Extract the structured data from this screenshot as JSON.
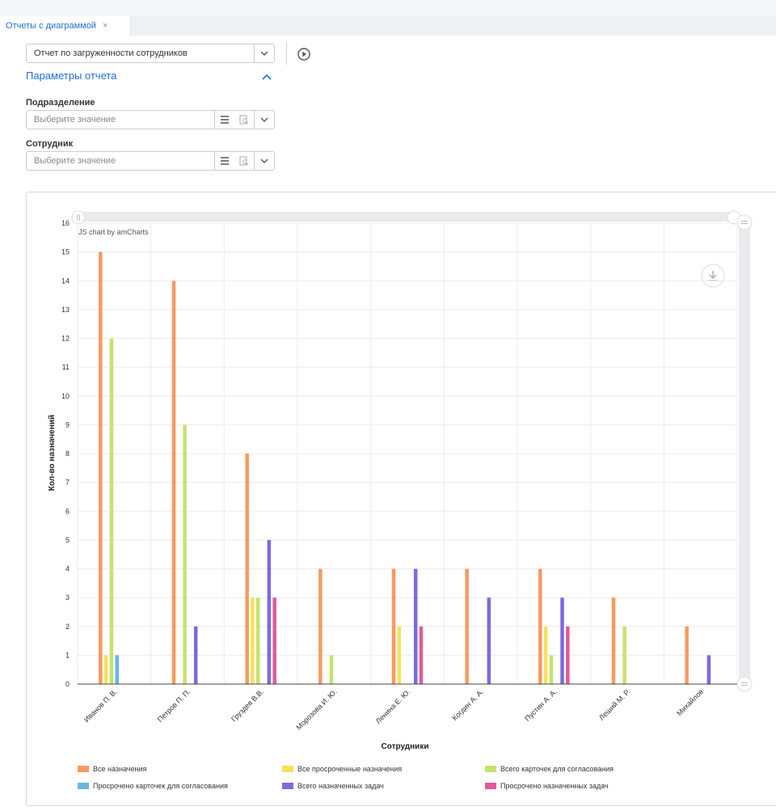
{
  "tab": {
    "label": "Отчеты с диаграммой",
    "close": "×"
  },
  "report_select": {
    "value": "Отчет по загруженности сотрудников"
  },
  "params": {
    "title": "Параметры отчета",
    "department": {
      "label": "Подразделение",
      "placeholder": "Выберите значение"
    },
    "employee": {
      "label": "Сотрудник",
      "placeholder": "Выберите значение"
    }
  },
  "chart_data": {
    "type": "bar",
    "watermark": "JS chart by amCharts",
    "xlabel": "Сотрудники",
    "ylabel": "Кол-во назначений",
    "ylim": [
      0,
      16
    ],
    "yticks": [
      0,
      1,
      2,
      3,
      4,
      5,
      6,
      7,
      8,
      9,
      10,
      11,
      12,
      13,
      14,
      15,
      16
    ],
    "grid": true,
    "legend_position": "bottom",
    "categories": [
      "Иванов П. В.",
      "Петров П. П.",
      "Груздев В.В.",
      "Морозова И. Ю.",
      "Ленина Е. Ю.",
      "Когдин А. А.",
      "Пустин А. А.",
      "Леший М. Р.",
      "Михайлов"
    ],
    "series": [
      {
        "name": "Все назначения",
        "color": "#f79a5f",
        "values": [
          15,
          14,
          8,
          4,
          4,
          4,
          4,
          3,
          2
        ]
      },
      {
        "name": "Все просроченные назначения",
        "color": "#f7e15a",
        "values": [
          1,
          0,
          3,
          0,
          2,
          0,
          2,
          0,
          0
        ]
      },
      {
        "name": "Всего карточек для согласования",
        "color": "#c6e26f",
        "values": [
          12,
          9,
          3,
          1,
          0,
          0,
          1,
          2,
          0
        ]
      },
      {
        "name": "Просрочено карточек для согласования",
        "color": "#6bb6e3",
        "values": [
          1,
          0,
          0,
          0,
          0,
          0,
          0,
          0,
          0
        ]
      },
      {
        "name": "Всего назначенных задач",
        "color": "#7b6ae0",
        "values": [
          0,
          2,
          5,
          0,
          4,
          3,
          3,
          0,
          1
        ]
      },
      {
        "name": "Просрочено назначенных задач",
        "color": "#e05a9b",
        "values": [
          0,
          0,
          3,
          0,
          2,
          0,
          2,
          0,
          0
        ]
      }
    ]
  }
}
